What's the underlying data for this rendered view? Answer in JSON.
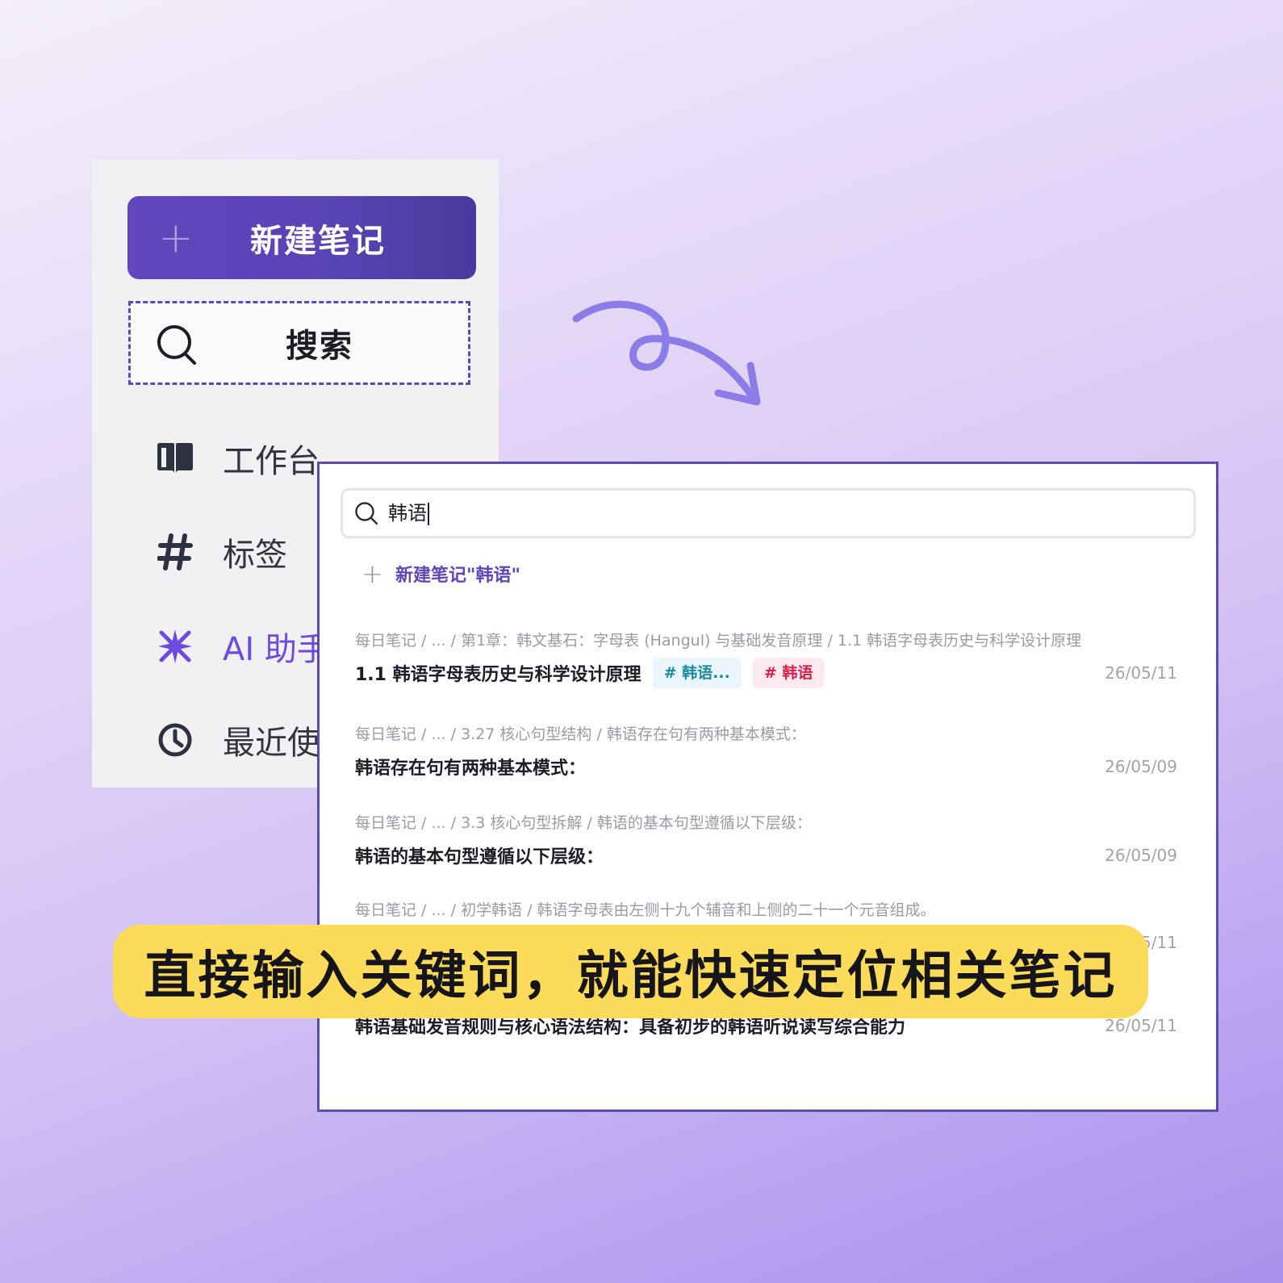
{
  "sidebar": {
    "new_note_label": "新建笔记",
    "search_label": "搜索",
    "items": [
      {
        "label": "工作台",
        "icon": "book-icon"
      },
      {
        "label": "标签",
        "icon": "hash-icon"
      },
      {
        "label": "AI 助手",
        "icon": "sparkle-icon"
      },
      {
        "label": "最近使",
        "icon": "clock-icon"
      }
    ]
  },
  "search_panel": {
    "query": "韩语",
    "create_label": "新建笔记\"韩语\"",
    "results": [
      {
        "path": "每日笔记 / ... / 第1章：韩文基石：字母表 (Hangul) 与基础发音原理 / 1.1 韩语字母表历史与科学设计原理",
        "title": "1.1 韩语字母表历史与科学设计原理",
        "tags": [
          "# 韩语...",
          "# 韩语"
        ],
        "date": "26/05/11"
      },
      {
        "path": "每日笔记 / ... / 3.27 核心句型结构 / 韩语存在句有两种基本模式：",
        "title": "韩语存在句有两种基本模式：",
        "date": "26/05/09"
      },
      {
        "path": "每日笔记 / ... / 3.3 核心句型拆解 / 韩语的基本句型遵循以下层级：",
        "title": "韩语的基本句型遵循以下层级：",
        "date": "26/05/09"
      },
      {
        "path": "每日笔记 / ... / 初学韩语 / 韩语字母表由左侧十九个辅音和上侧的二十一个元音组成。",
        "title": "",
        "date": "5/11"
      },
      {
        "path": "",
        "title": "韩语基础发音规则与核心语法结构：具备初步的韩语听说读写综合能力",
        "date": "26/05/11"
      }
    ]
  },
  "caption": "直接输入关键词，就能快速定位相关笔记",
  "colors": {
    "accent": "#5d48b7",
    "ai": "#6e4be0",
    "caption_bg": "#fcda5a",
    "tag_teal": "#1b8ba3",
    "tag_red": "#d2224b",
    "arrow": "#8c7ce8"
  }
}
